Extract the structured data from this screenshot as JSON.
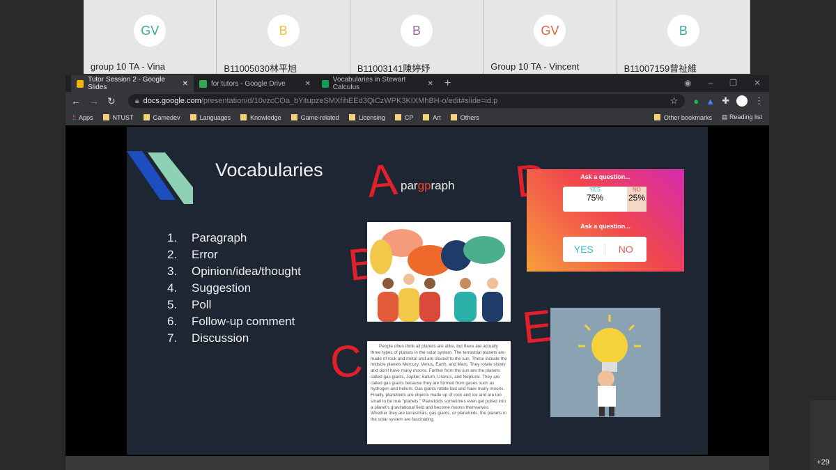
{
  "participants": [
    {
      "initials": "GV",
      "name": "group 10 TA - Vina",
      "color": "#3aa89a"
    },
    {
      "initials": "B",
      "name": "B11005030林平旭",
      "color": "#e8c23a"
    },
    {
      "initials": "B",
      "name": "B11003141陳婷妤",
      "color": "#a06aa8"
    },
    {
      "initials": "GV",
      "name": "Group 10 TA - Vincent",
      "color": "#e0643a"
    },
    {
      "initials": "B",
      "name": "B11007159曾祉維",
      "color": "#3aa89a"
    }
  ],
  "more_participants": "+29",
  "browser": {
    "tabs": [
      {
        "label": "Tutor Session 2 - Google Slides",
        "icon": "slides-icon",
        "color": "#f4b400"
      },
      {
        "label": "for tutors - Google Drive",
        "icon": "drive-icon",
        "color": "#34a853"
      },
      {
        "label": "Vocabularies in Stewart Calculus",
        "icon": "sheets-icon",
        "color": "#0f9d58"
      }
    ],
    "url_domain": "docs.google.com",
    "url_path": "/presentation/d/10vzcCOa_bYitupzeSMXfihEEd3QiCzWPK3KIXMhBH-o/edit#slide=id.p",
    "bookmarks": [
      "Apps",
      "NTUST",
      "Gamedev",
      "Languages",
      "Knowledge",
      "Game-related",
      "Licensing",
      "CP",
      "Art",
      "Others"
    ],
    "other_bookmarks": "Other bookmarks",
    "reading_list": "Reading list"
  },
  "slide": {
    "title": "Vocabularies",
    "items": [
      "Paragraph",
      "Error",
      "Opinion/idea/thought",
      "Suggestion",
      "Poll",
      "Follow-up comment",
      "Discussion"
    ],
    "word_a": "par",
    "word_b": "gp",
    "word_c": "raph",
    "letters": [
      "A",
      "B",
      "C",
      "D",
      "E"
    ],
    "poll": {
      "question": "Ask a question...",
      "yes": "YES",
      "no": "NO",
      "yes_pct": "75%",
      "no_pct": "25%",
      "yes_value": 75
    },
    "paragraph": "People often think all planets are alike, but there are actually three types of planets in the solar system. The terrestrial planets are made of rock and metal and are closest to the sun. These include the midsize planets Mercury, Venus, Earth, and Mars. They rotate slowly and don't have many moons. Farther from the sun are the planets called gas giants, Jupiter, Saturn, Uranus, and Neptune. They are called gas giants because they are formed from gases such as hydrogen and helium. Gas giants rotate fast and have many moons. Finally, planetoids are objects made up of rock and ice and are too small to be true \"planets.\" Planetoids sometimes even get pulled into a planet's gravitational field and become moons themselves. Whether they are terrestrials, gas giants, or planetoids, the planets in the solar system are fascinating."
  }
}
